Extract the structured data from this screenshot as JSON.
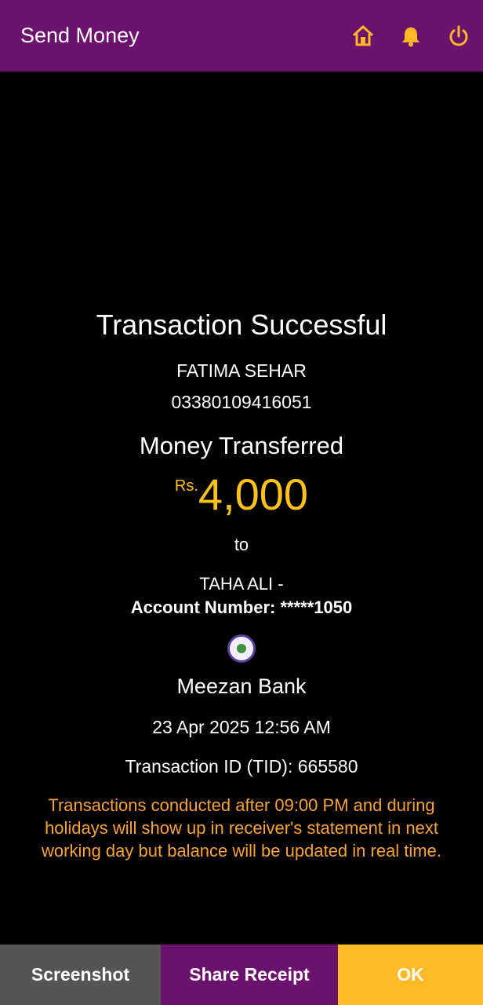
{
  "appbar": {
    "title": "Send Money",
    "icons": [
      "home-icon",
      "bell-icon",
      "power-icon"
    ],
    "icon_color": "#ffb927",
    "background": "#6b126c"
  },
  "receipt": {
    "status": "Transaction Successful",
    "sender_name": "FATIMA SEHAR",
    "sender_account": "03380109416051",
    "headline": "Money Transferred",
    "currency": "Rs.",
    "amount": "4,000",
    "to_label": "to",
    "receiver_name": "TAHA ALI -",
    "receiver_account": "Account Number: *****1050",
    "bank_icon": "bank-logo-icon",
    "bank_name": "Meezan Bank",
    "datetime": "23 Apr 2025 12:56 AM",
    "tid": "Transaction ID (TID): 665580",
    "notice": "Transactions conducted after 09:00 PM and during holidays will show up in receiver's statement in next working day but balance will be updated in real time."
  },
  "actions": {
    "screenshot": "Screenshot",
    "share": "Share Receipt",
    "ok": "OK"
  },
  "colors": {
    "amount": "#ffc21a",
    "notice": "#f6a33a",
    "screenshot_button": "#555555",
    "share_button": "#6b126c",
    "ok_button": "#ffb927"
  }
}
